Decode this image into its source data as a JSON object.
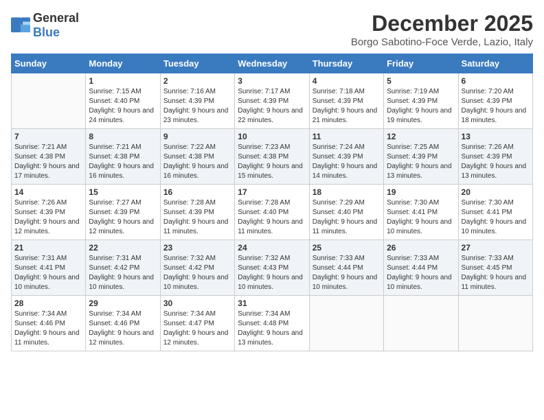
{
  "header": {
    "logo_general": "General",
    "logo_blue": "Blue",
    "month_year": "December 2025",
    "location": "Borgo Sabotino-Foce Verde, Lazio, Italy"
  },
  "days_of_week": [
    "Sunday",
    "Monday",
    "Tuesday",
    "Wednesday",
    "Thursday",
    "Friday",
    "Saturday"
  ],
  "weeks": [
    [
      {
        "day": "",
        "sunrise": "",
        "sunset": "",
        "daylight": ""
      },
      {
        "day": "1",
        "sunrise": "Sunrise: 7:15 AM",
        "sunset": "Sunset: 4:40 PM",
        "daylight": "Daylight: 9 hours and 24 minutes."
      },
      {
        "day": "2",
        "sunrise": "Sunrise: 7:16 AM",
        "sunset": "Sunset: 4:39 PM",
        "daylight": "Daylight: 9 hours and 23 minutes."
      },
      {
        "day": "3",
        "sunrise": "Sunrise: 7:17 AM",
        "sunset": "Sunset: 4:39 PM",
        "daylight": "Daylight: 9 hours and 22 minutes."
      },
      {
        "day": "4",
        "sunrise": "Sunrise: 7:18 AM",
        "sunset": "Sunset: 4:39 PM",
        "daylight": "Daylight: 9 hours and 21 minutes."
      },
      {
        "day": "5",
        "sunrise": "Sunrise: 7:19 AM",
        "sunset": "Sunset: 4:39 PM",
        "daylight": "Daylight: 9 hours and 19 minutes."
      },
      {
        "day": "6",
        "sunrise": "Sunrise: 7:20 AM",
        "sunset": "Sunset: 4:39 PM",
        "daylight": "Daylight: 9 hours and 18 minutes."
      }
    ],
    [
      {
        "day": "7",
        "sunrise": "Sunrise: 7:21 AM",
        "sunset": "Sunset: 4:38 PM",
        "daylight": "Daylight: 9 hours and 17 minutes."
      },
      {
        "day": "8",
        "sunrise": "Sunrise: 7:21 AM",
        "sunset": "Sunset: 4:38 PM",
        "daylight": "Daylight: 9 hours and 16 minutes."
      },
      {
        "day": "9",
        "sunrise": "Sunrise: 7:22 AM",
        "sunset": "Sunset: 4:38 PM",
        "daylight": "Daylight: 9 hours and 16 minutes."
      },
      {
        "day": "10",
        "sunrise": "Sunrise: 7:23 AM",
        "sunset": "Sunset: 4:38 PM",
        "daylight": "Daylight: 9 hours and 15 minutes."
      },
      {
        "day": "11",
        "sunrise": "Sunrise: 7:24 AM",
        "sunset": "Sunset: 4:39 PM",
        "daylight": "Daylight: 9 hours and 14 minutes."
      },
      {
        "day": "12",
        "sunrise": "Sunrise: 7:25 AM",
        "sunset": "Sunset: 4:39 PM",
        "daylight": "Daylight: 9 hours and 13 minutes."
      },
      {
        "day": "13",
        "sunrise": "Sunrise: 7:26 AM",
        "sunset": "Sunset: 4:39 PM",
        "daylight": "Daylight: 9 hours and 13 minutes."
      }
    ],
    [
      {
        "day": "14",
        "sunrise": "Sunrise: 7:26 AM",
        "sunset": "Sunset: 4:39 PM",
        "daylight": "Daylight: 9 hours and 12 minutes."
      },
      {
        "day": "15",
        "sunrise": "Sunrise: 7:27 AM",
        "sunset": "Sunset: 4:39 PM",
        "daylight": "Daylight: 9 hours and 12 minutes."
      },
      {
        "day": "16",
        "sunrise": "Sunrise: 7:28 AM",
        "sunset": "Sunset: 4:39 PM",
        "daylight": "Daylight: 9 hours and 11 minutes."
      },
      {
        "day": "17",
        "sunrise": "Sunrise: 7:28 AM",
        "sunset": "Sunset: 4:40 PM",
        "daylight": "Daylight: 9 hours and 11 minutes."
      },
      {
        "day": "18",
        "sunrise": "Sunrise: 7:29 AM",
        "sunset": "Sunset: 4:40 PM",
        "daylight": "Daylight: 9 hours and 11 minutes."
      },
      {
        "day": "19",
        "sunrise": "Sunrise: 7:30 AM",
        "sunset": "Sunset: 4:41 PM",
        "daylight": "Daylight: 9 hours and 10 minutes."
      },
      {
        "day": "20",
        "sunrise": "Sunrise: 7:30 AM",
        "sunset": "Sunset: 4:41 PM",
        "daylight": "Daylight: 9 hours and 10 minutes."
      }
    ],
    [
      {
        "day": "21",
        "sunrise": "Sunrise: 7:31 AM",
        "sunset": "Sunset: 4:41 PM",
        "daylight": "Daylight: 9 hours and 10 minutes."
      },
      {
        "day": "22",
        "sunrise": "Sunrise: 7:31 AM",
        "sunset": "Sunset: 4:42 PM",
        "daylight": "Daylight: 9 hours and 10 minutes."
      },
      {
        "day": "23",
        "sunrise": "Sunrise: 7:32 AM",
        "sunset": "Sunset: 4:42 PM",
        "daylight": "Daylight: 9 hours and 10 minutes."
      },
      {
        "day": "24",
        "sunrise": "Sunrise: 7:32 AM",
        "sunset": "Sunset: 4:43 PM",
        "daylight": "Daylight: 9 hours and 10 minutes."
      },
      {
        "day": "25",
        "sunrise": "Sunrise: 7:33 AM",
        "sunset": "Sunset: 4:44 PM",
        "daylight": "Daylight: 9 hours and 10 minutes."
      },
      {
        "day": "26",
        "sunrise": "Sunrise: 7:33 AM",
        "sunset": "Sunset: 4:44 PM",
        "daylight": "Daylight: 9 hours and 10 minutes."
      },
      {
        "day": "27",
        "sunrise": "Sunrise: 7:33 AM",
        "sunset": "Sunset: 4:45 PM",
        "daylight": "Daylight: 9 hours and 11 minutes."
      }
    ],
    [
      {
        "day": "28",
        "sunrise": "Sunrise: 7:34 AM",
        "sunset": "Sunset: 4:46 PM",
        "daylight": "Daylight: 9 hours and 11 minutes."
      },
      {
        "day": "29",
        "sunrise": "Sunrise: 7:34 AM",
        "sunset": "Sunset: 4:46 PM",
        "daylight": "Daylight: 9 hours and 12 minutes."
      },
      {
        "day": "30",
        "sunrise": "Sunrise: 7:34 AM",
        "sunset": "Sunset: 4:47 PM",
        "daylight": "Daylight: 9 hours and 12 minutes."
      },
      {
        "day": "31",
        "sunrise": "Sunrise: 7:34 AM",
        "sunset": "Sunset: 4:48 PM",
        "daylight": "Daylight: 9 hours and 13 minutes."
      },
      {
        "day": "",
        "sunrise": "",
        "sunset": "",
        "daylight": ""
      },
      {
        "day": "",
        "sunrise": "",
        "sunset": "",
        "daylight": ""
      },
      {
        "day": "",
        "sunrise": "",
        "sunset": "",
        "daylight": ""
      }
    ]
  ]
}
